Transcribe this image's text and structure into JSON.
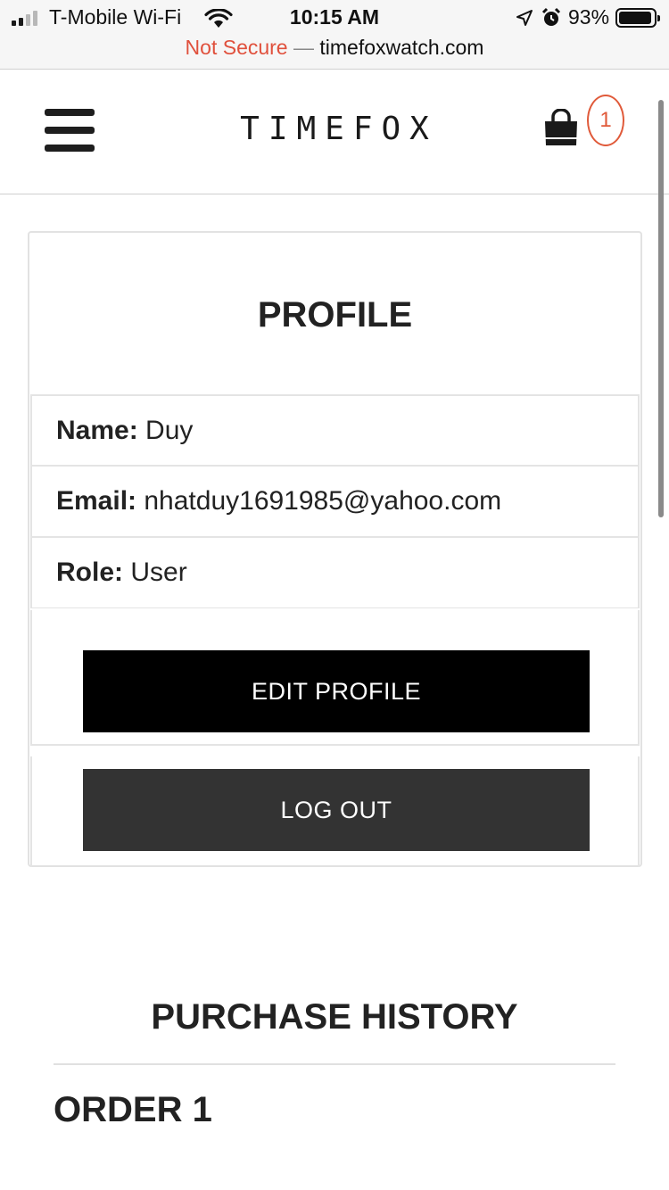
{
  "status_bar": {
    "carrier": "T-Mobile Wi-Fi",
    "time": "10:15 AM",
    "battery": "93%",
    "battery_level": 0.93,
    "icons": [
      "signal-icon",
      "wifi-icon",
      "location-arrow-icon",
      "alarm-clock-icon",
      "battery-icon"
    ]
  },
  "url_bar": {
    "security": "Not Secure",
    "separator": " — ",
    "domain": "timefoxwatch.com"
  },
  "header": {
    "logo": "TIMEFOX",
    "cart_count": "1",
    "icons": [
      "hamburger-menu-icon",
      "shopping-bag-icon"
    ]
  },
  "profile": {
    "title": "PROFILE",
    "name_label": "Name:",
    "name_value": "Duy",
    "email_label": "Email:",
    "email_value": "nhatduy1691985@yahoo.com",
    "role_label": "Role:",
    "role_value": "User",
    "edit_button": "EDIT PROFILE",
    "logout_button": "LOG OUT"
  },
  "history": {
    "title": "PURCHASE HISTORY",
    "order_title": "ORDER 1"
  },
  "colors": {
    "accent_badge": "#e05a3a",
    "insecure_text": "#e0503c",
    "edit_button_bg": "#000000",
    "logout_button_bg": "#333333"
  }
}
